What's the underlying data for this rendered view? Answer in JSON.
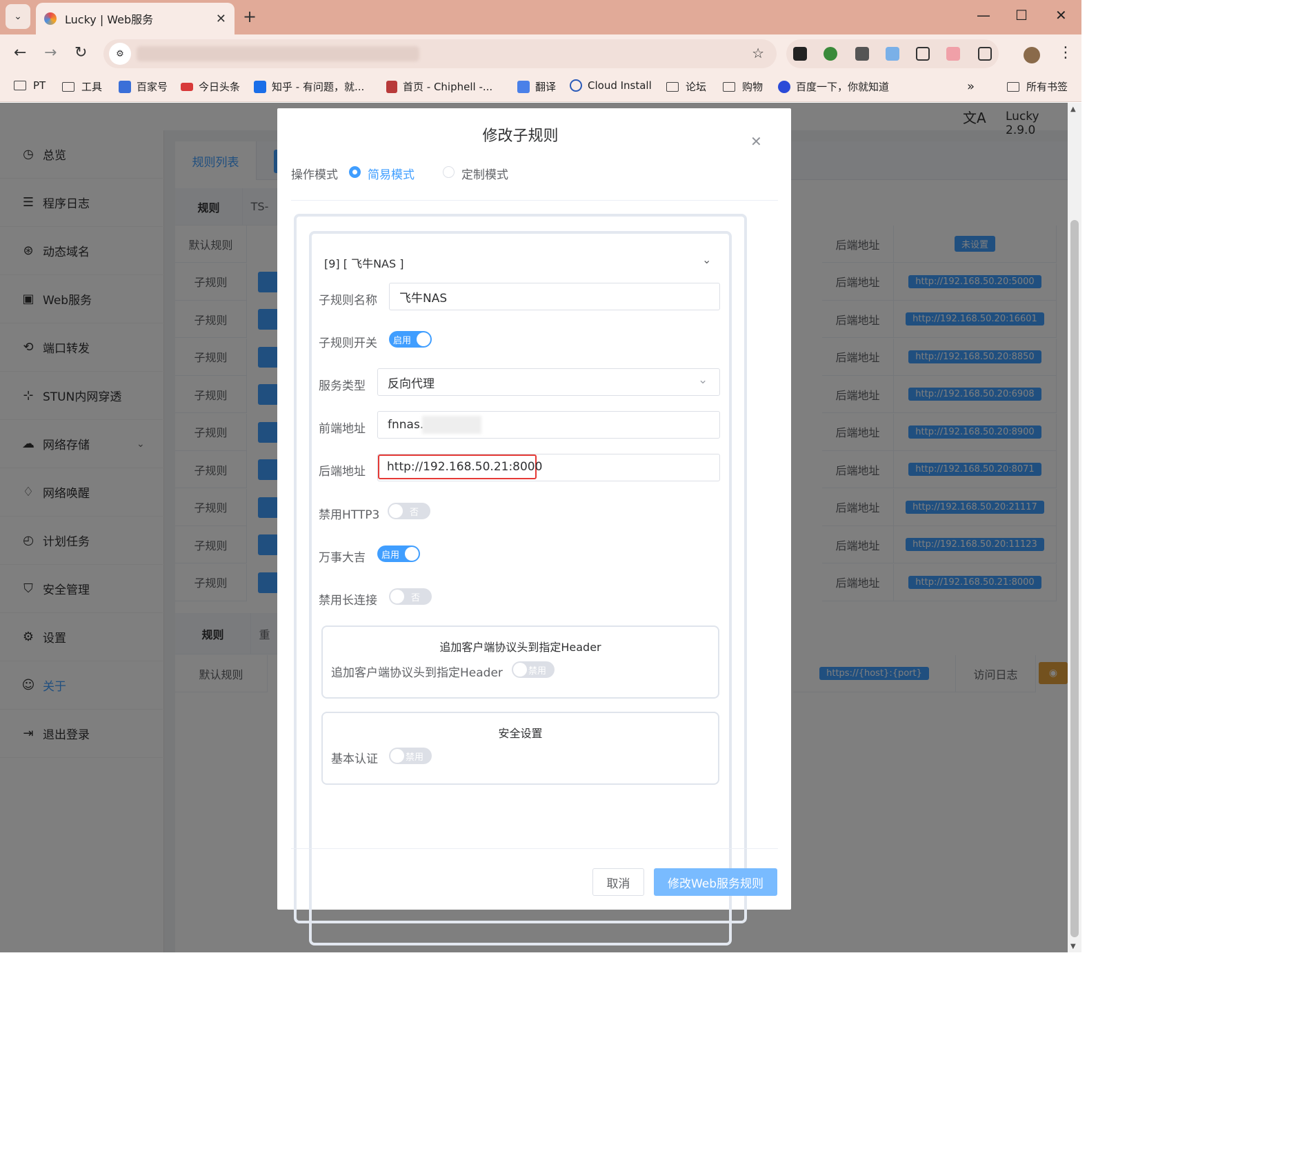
{
  "browser": {
    "tab_title": "Lucky | Web服务",
    "bookmarks": [
      "PT",
      "工具",
      "百家号",
      "今日头条",
      "知乎 - 有问题，就...",
      "首页 - Chiphell -...",
      "翻译",
      "Cloud Install",
      "论坛",
      "购物",
      "百度一下，你就知道"
    ],
    "more_bookmarks": "»",
    "all_bookmarks": "所有书签"
  },
  "app": {
    "version": "Lucky 2.9.0",
    "sidebar": [
      {
        "label": "总览",
        "icon": "dashboard-icon"
      },
      {
        "label": "程序日志",
        "icon": "log-icon"
      },
      {
        "label": "动态域名",
        "icon": "dns-icon"
      },
      {
        "label": "Web服务",
        "icon": "web-icon"
      },
      {
        "label": "端口转发",
        "icon": "port-forward-icon"
      },
      {
        "label": "STUN内网穿透",
        "icon": "stun-icon"
      },
      {
        "label": "网络存储",
        "icon": "cloud-icon"
      },
      {
        "label": "网络唤醒",
        "icon": "bell-icon"
      },
      {
        "label": "计划任务",
        "icon": "clock-icon"
      },
      {
        "label": "安全管理",
        "icon": "shield-icon"
      },
      {
        "label": "设置",
        "icon": "gear-icon"
      },
      {
        "label": "关于",
        "icon": "about-icon"
      },
      {
        "label": "退出登录",
        "icon": "logout-icon"
      }
    ],
    "main_tab": "规则列表",
    "rule_header": "规则",
    "rule_tag": "TS-",
    "default_rule": "默认规则",
    "sub_rule": "子规则",
    "backend_label": "后端地址",
    "unset": "未设置",
    "backends": [
      "http://192.168.50.20:5000",
      "http://192.168.50.20:16601",
      "http://192.168.50.20:8850",
      "http://192.168.50.20:6908",
      "http://192.168.50.20:8900",
      "http://192.168.50.20:8071",
      "http://192.168.50.20:21117",
      "http://192.168.50.20:11123",
      "http://192.168.50.21:8000"
    ],
    "rule2_header": "规则",
    "rule2_tag": "重",
    "rule2_default": "默认规则",
    "rule2_backend": "https://{host}:{port}",
    "access_log": "访问日志"
  },
  "dialog": {
    "title": "修改子规则",
    "mode_label": "操作模式",
    "mode_simple": "简易模式",
    "mode_custom": "定制模式",
    "subrule_select": "[9] [ 飞牛NAS ]",
    "name_label": "子规则名称",
    "name_value": "飞牛NAS",
    "switch_label": "子规则开关",
    "switch_value": "启用",
    "service_label": "服务类型",
    "service_value": "反向代理",
    "front_label": "前端地址",
    "front_value": "fnnas.",
    "backend_label": "后端地址",
    "backend_value": "http://192.168.50.21:8000",
    "http3_label": "禁用HTTP3",
    "http3_value": "否",
    "lucky_label": "万事大吉",
    "lucky_value": "启用",
    "keepalive_label": "禁用长连接",
    "keepalive_value": "否",
    "header_group_title": "追加客户端协议头到指定Header",
    "header_label": "追加客户端协议头到指定Header",
    "header_value": "禁用",
    "security_title": "安全设置",
    "auth_label": "基本认证",
    "auth_value": "禁用",
    "cancel": "取消",
    "submit": "修改Web服务规则"
  }
}
